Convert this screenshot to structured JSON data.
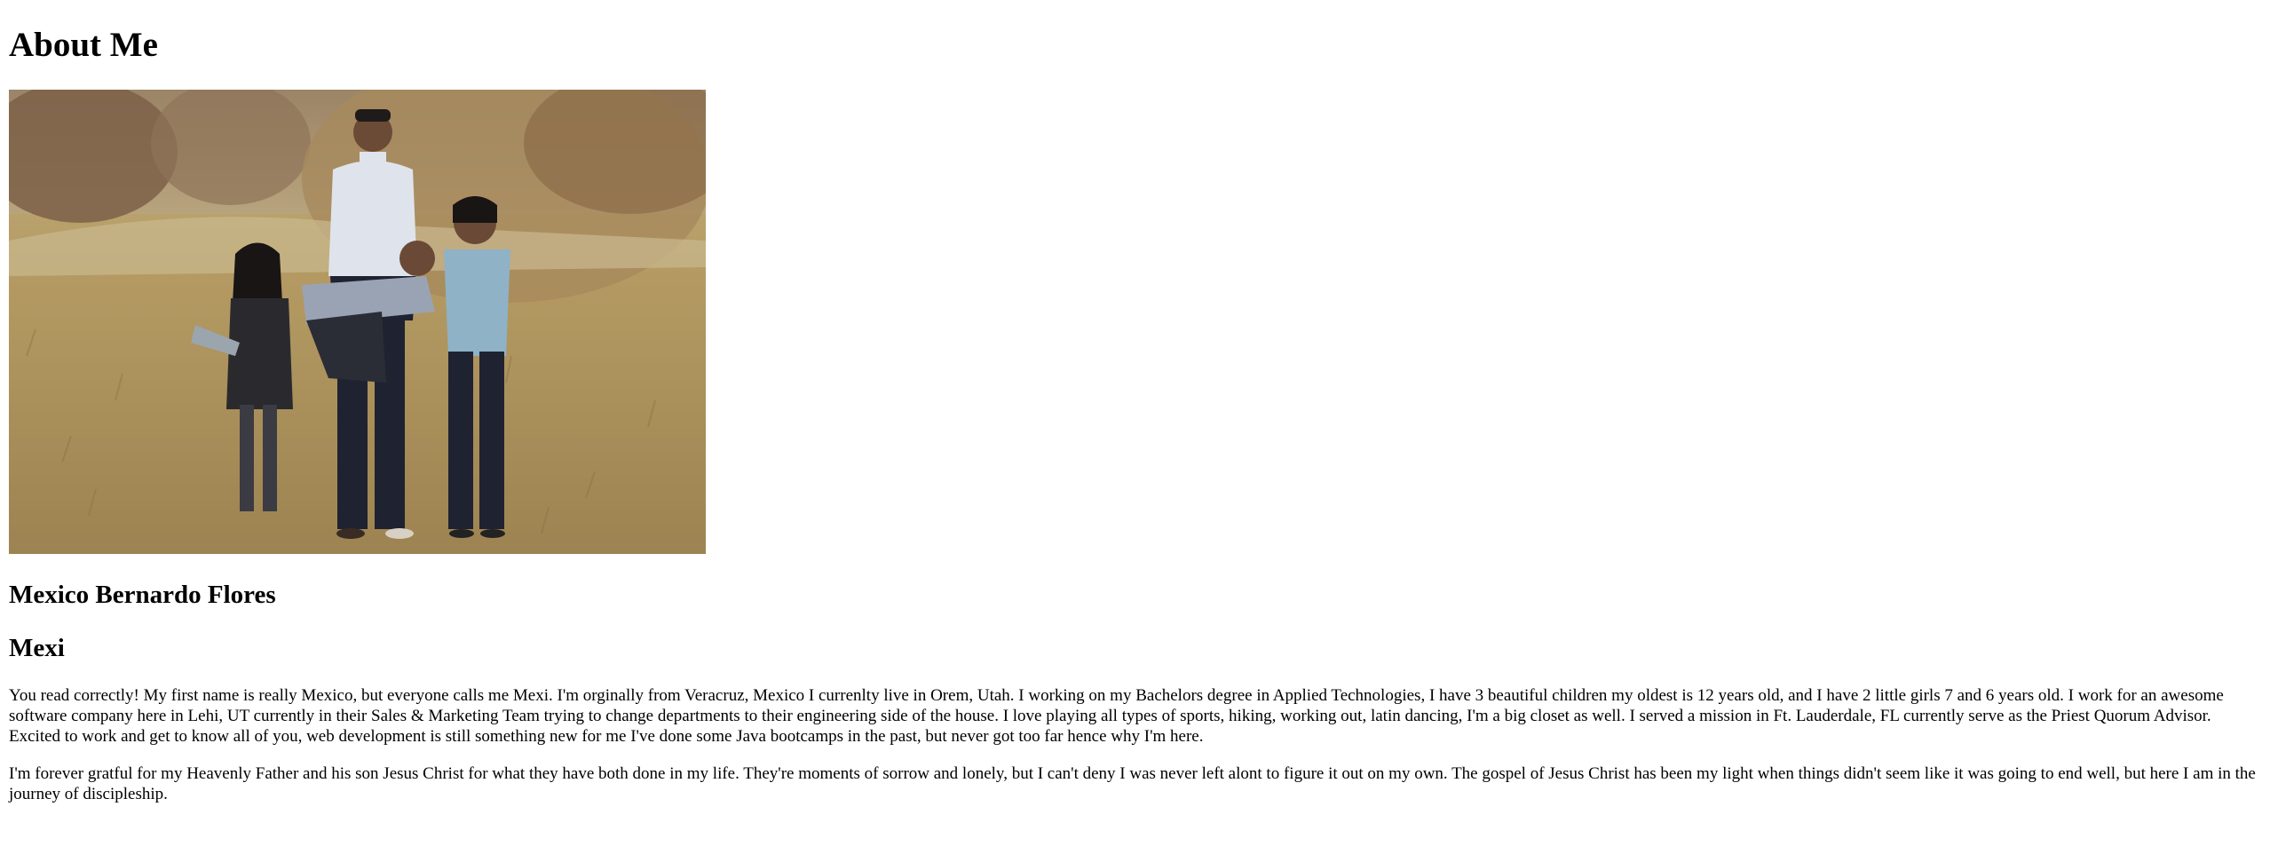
{
  "page": {
    "heading": "About Me",
    "photo": {
      "alt": "Family photo in a grassy field",
      "colors": {
        "grass": "#b39a64",
        "sky": "#cfc7a8",
        "trees": "#8c6f4a",
        "shirt": "#dfe3ec",
        "dark": "#1f2230",
        "blue_shirt": "#8fb2c7"
      }
    },
    "full_name": "Mexico Bernardo Flores",
    "nickname": "Mexi",
    "bio": [
      "You read correctly! My first name is really Mexico, but everyone calls me Mexi. I'm orginally from Veracruz, Mexico I currenlty live in Orem, Utah. I working on my Bachelors degree in Applied Technologies, I have 3 beautiful children my oldest is 12 years old, and I have 2 little girls 7 and 6 years old. I work for an awesome software company here in Lehi, UT currently in their Sales & Marketing Team trying to change departments to their engineering side of the house. I love playing all types of sports, hiking, working out, latin dancing, I'm a big closet as well. I served a mission in Ft. Lauderdale, FL currently serve as the Priest Quorum Advisor. Excited to work and get to know all of you, web development is still something new for me I've done some Java bootcamps in the past, but never got too far hence why I'm here.",
      "I'm forever gratful for my Heavenly Father and his son Jesus Christ for what they have both done in my life. They're moments of sorrow and lonely, but I can't deny I was never left alont to figure it out on my own. The gospel of Jesus Christ has been my light when things didn't seem like it was going to end well, but here I am in the journey of discipleship."
    ]
  }
}
